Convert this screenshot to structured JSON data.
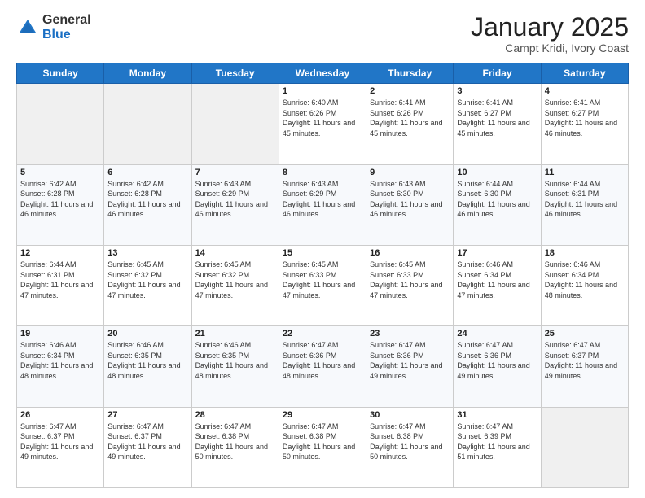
{
  "logo": {
    "general": "General",
    "blue": "Blue"
  },
  "header": {
    "month": "January 2025",
    "location": "Campt Kridi, Ivory Coast"
  },
  "weekdays": [
    "Sunday",
    "Monday",
    "Tuesday",
    "Wednesday",
    "Thursday",
    "Friday",
    "Saturday"
  ],
  "weeks": [
    [
      {
        "day": "",
        "sunrise": "",
        "sunset": "",
        "daylight": ""
      },
      {
        "day": "",
        "sunrise": "",
        "sunset": "",
        "daylight": ""
      },
      {
        "day": "",
        "sunrise": "",
        "sunset": "",
        "daylight": ""
      },
      {
        "day": "1",
        "sunrise": "Sunrise: 6:40 AM",
        "sunset": "Sunset: 6:26 PM",
        "daylight": "Daylight: 11 hours and 45 minutes."
      },
      {
        "day": "2",
        "sunrise": "Sunrise: 6:41 AM",
        "sunset": "Sunset: 6:26 PM",
        "daylight": "Daylight: 11 hours and 45 minutes."
      },
      {
        "day": "3",
        "sunrise": "Sunrise: 6:41 AM",
        "sunset": "Sunset: 6:27 PM",
        "daylight": "Daylight: 11 hours and 45 minutes."
      },
      {
        "day": "4",
        "sunrise": "Sunrise: 6:41 AM",
        "sunset": "Sunset: 6:27 PM",
        "daylight": "Daylight: 11 hours and 46 minutes."
      }
    ],
    [
      {
        "day": "5",
        "sunrise": "Sunrise: 6:42 AM",
        "sunset": "Sunset: 6:28 PM",
        "daylight": "Daylight: 11 hours and 46 minutes."
      },
      {
        "day": "6",
        "sunrise": "Sunrise: 6:42 AM",
        "sunset": "Sunset: 6:28 PM",
        "daylight": "Daylight: 11 hours and 46 minutes."
      },
      {
        "day": "7",
        "sunrise": "Sunrise: 6:43 AM",
        "sunset": "Sunset: 6:29 PM",
        "daylight": "Daylight: 11 hours and 46 minutes."
      },
      {
        "day": "8",
        "sunrise": "Sunrise: 6:43 AM",
        "sunset": "Sunset: 6:29 PM",
        "daylight": "Daylight: 11 hours and 46 minutes."
      },
      {
        "day": "9",
        "sunrise": "Sunrise: 6:43 AM",
        "sunset": "Sunset: 6:30 PM",
        "daylight": "Daylight: 11 hours and 46 minutes."
      },
      {
        "day": "10",
        "sunrise": "Sunrise: 6:44 AM",
        "sunset": "Sunset: 6:30 PM",
        "daylight": "Daylight: 11 hours and 46 minutes."
      },
      {
        "day": "11",
        "sunrise": "Sunrise: 6:44 AM",
        "sunset": "Sunset: 6:31 PM",
        "daylight": "Daylight: 11 hours and 46 minutes."
      }
    ],
    [
      {
        "day": "12",
        "sunrise": "Sunrise: 6:44 AM",
        "sunset": "Sunset: 6:31 PM",
        "daylight": "Daylight: 11 hours and 47 minutes."
      },
      {
        "day": "13",
        "sunrise": "Sunrise: 6:45 AM",
        "sunset": "Sunset: 6:32 PM",
        "daylight": "Daylight: 11 hours and 47 minutes."
      },
      {
        "day": "14",
        "sunrise": "Sunrise: 6:45 AM",
        "sunset": "Sunset: 6:32 PM",
        "daylight": "Daylight: 11 hours and 47 minutes."
      },
      {
        "day": "15",
        "sunrise": "Sunrise: 6:45 AM",
        "sunset": "Sunset: 6:33 PM",
        "daylight": "Daylight: 11 hours and 47 minutes."
      },
      {
        "day": "16",
        "sunrise": "Sunrise: 6:45 AM",
        "sunset": "Sunset: 6:33 PM",
        "daylight": "Daylight: 11 hours and 47 minutes."
      },
      {
        "day": "17",
        "sunrise": "Sunrise: 6:46 AM",
        "sunset": "Sunset: 6:34 PM",
        "daylight": "Daylight: 11 hours and 47 minutes."
      },
      {
        "day": "18",
        "sunrise": "Sunrise: 6:46 AM",
        "sunset": "Sunset: 6:34 PM",
        "daylight": "Daylight: 11 hours and 48 minutes."
      }
    ],
    [
      {
        "day": "19",
        "sunrise": "Sunrise: 6:46 AM",
        "sunset": "Sunset: 6:34 PM",
        "daylight": "Daylight: 11 hours and 48 minutes."
      },
      {
        "day": "20",
        "sunrise": "Sunrise: 6:46 AM",
        "sunset": "Sunset: 6:35 PM",
        "daylight": "Daylight: 11 hours and 48 minutes."
      },
      {
        "day": "21",
        "sunrise": "Sunrise: 6:46 AM",
        "sunset": "Sunset: 6:35 PM",
        "daylight": "Daylight: 11 hours and 48 minutes."
      },
      {
        "day": "22",
        "sunrise": "Sunrise: 6:47 AM",
        "sunset": "Sunset: 6:36 PM",
        "daylight": "Daylight: 11 hours and 48 minutes."
      },
      {
        "day": "23",
        "sunrise": "Sunrise: 6:47 AM",
        "sunset": "Sunset: 6:36 PM",
        "daylight": "Daylight: 11 hours and 49 minutes."
      },
      {
        "day": "24",
        "sunrise": "Sunrise: 6:47 AM",
        "sunset": "Sunset: 6:36 PM",
        "daylight": "Daylight: 11 hours and 49 minutes."
      },
      {
        "day": "25",
        "sunrise": "Sunrise: 6:47 AM",
        "sunset": "Sunset: 6:37 PM",
        "daylight": "Daylight: 11 hours and 49 minutes."
      }
    ],
    [
      {
        "day": "26",
        "sunrise": "Sunrise: 6:47 AM",
        "sunset": "Sunset: 6:37 PM",
        "daylight": "Daylight: 11 hours and 49 minutes."
      },
      {
        "day": "27",
        "sunrise": "Sunrise: 6:47 AM",
        "sunset": "Sunset: 6:37 PM",
        "daylight": "Daylight: 11 hours and 49 minutes."
      },
      {
        "day": "28",
        "sunrise": "Sunrise: 6:47 AM",
        "sunset": "Sunset: 6:38 PM",
        "daylight": "Daylight: 11 hours and 50 minutes."
      },
      {
        "day": "29",
        "sunrise": "Sunrise: 6:47 AM",
        "sunset": "Sunset: 6:38 PM",
        "daylight": "Daylight: 11 hours and 50 minutes."
      },
      {
        "day": "30",
        "sunrise": "Sunrise: 6:47 AM",
        "sunset": "Sunset: 6:38 PM",
        "daylight": "Daylight: 11 hours and 50 minutes."
      },
      {
        "day": "31",
        "sunrise": "Sunrise: 6:47 AM",
        "sunset": "Sunset: 6:39 PM",
        "daylight": "Daylight: 11 hours and 51 minutes."
      },
      {
        "day": "",
        "sunrise": "",
        "sunset": "",
        "daylight": ""
      }
    ]
  ]
}
